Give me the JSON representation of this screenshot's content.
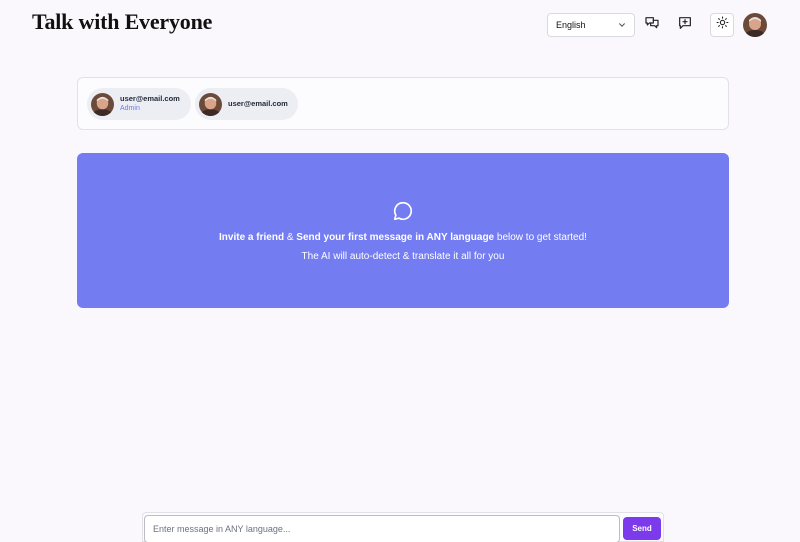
{
  "header": {
    "title": "Talk with Everyone",
    "language": {
      "selected": "English",
      "icon": "chevron-down-icon"
    },
    "buttons": [
      {
        "name": "chats",
        "icon": "chats-icon"
      },
      {
        "name": "new-chat",
        "icon": "message-plus-icon"
      },
      {
        "name": "theme-toggle",
        "icon": "sun-icon"
      }
    ],
    "avatar": "user-avatar"
  },
  "participants": [
    {
      "email": "user@email.com",
      "role": "Admin"
    },
    {
      "email": "user@email.com",
      "role": ""
    }
  ],
  "banner": {
    "icon": "chat-bubble-icon",
    "line1": {
      "part1": "Invite a friend",
      "part2": " & ",
      "part3": "Send your first message in ANY language",
      "part4": " below to get started!"
    },
    "line2": "The AI will auto-detect & translate it all for you",
    "color": "#737cf1"
  },
  "composer": {
    "placeholder": "Enter message in ANY language...",
    "value": "",
    "send_label": "Send",
    "send_color": "#7c3aed"
  }
}
